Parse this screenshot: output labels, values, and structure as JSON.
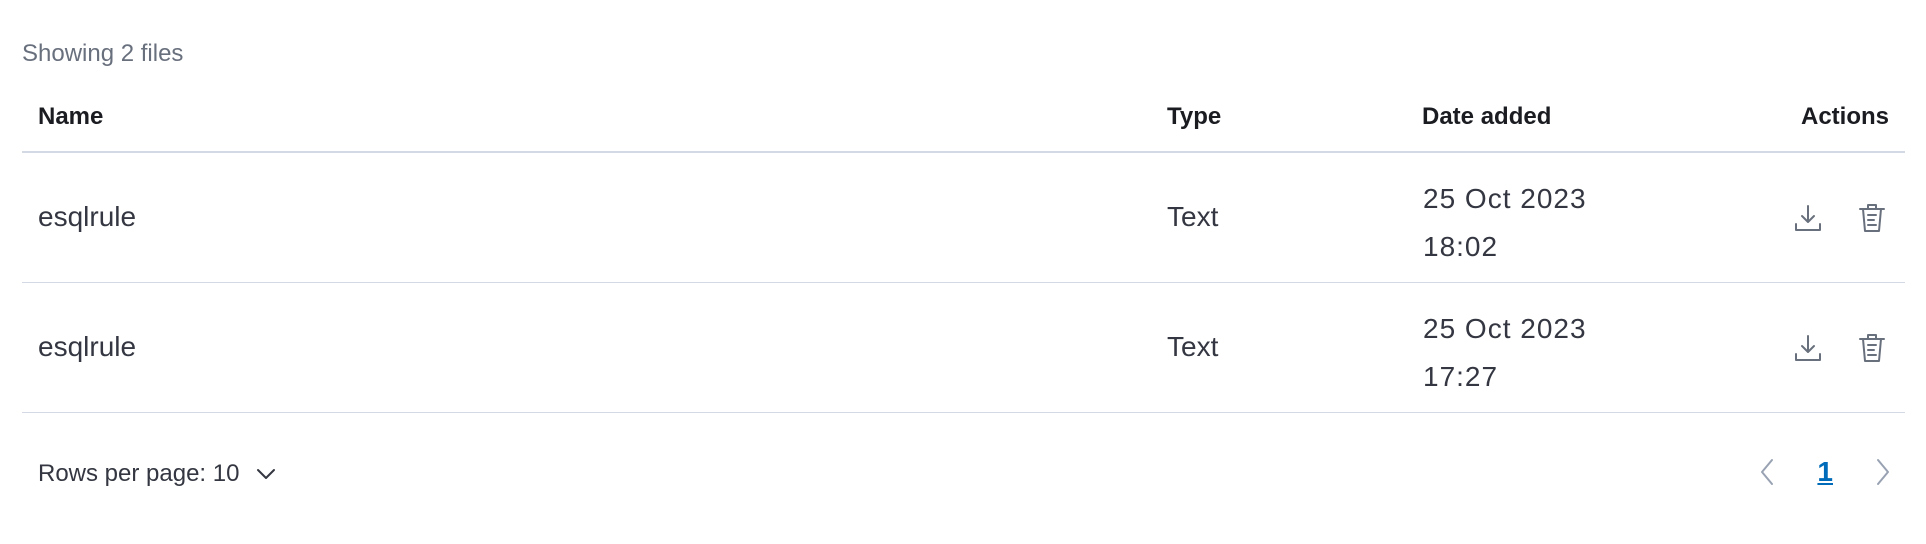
{
  "summary": "Showing 2 files",
  "table": {
    "columns": [
      "Name",
      "Type",
      "Date added",
      "Actions"
    ],
    "rows": [
      {
        "name": "esqlrule",
        "type": "Text",
        "date_line1": "25 Oct 2023",
        "date_line2": "18:02"
      },
      {
        "name": "esqlrule",
        "type": "Text",
        "date_line1": "25 Oct 2023",
        "date_line2": "17:27"
      }
    ]
  },
  "footer": {
    "rows_per_page": "Rows per page: 10",
    "current_page": "1"
  },
  "icons": {
    "download": "download-icon",
    "delete": "trash-icon",
    "chevron_down": "chevron-down-icon",
    "prev": "chevron-left-icon",
    "next": "chevron-right-icon"
  },
  "colors": {
    "link": "#006bb8",
    "border": "#d3dae6",
    "muted": "#69707d",
    "text": "#343741"
  }
}
